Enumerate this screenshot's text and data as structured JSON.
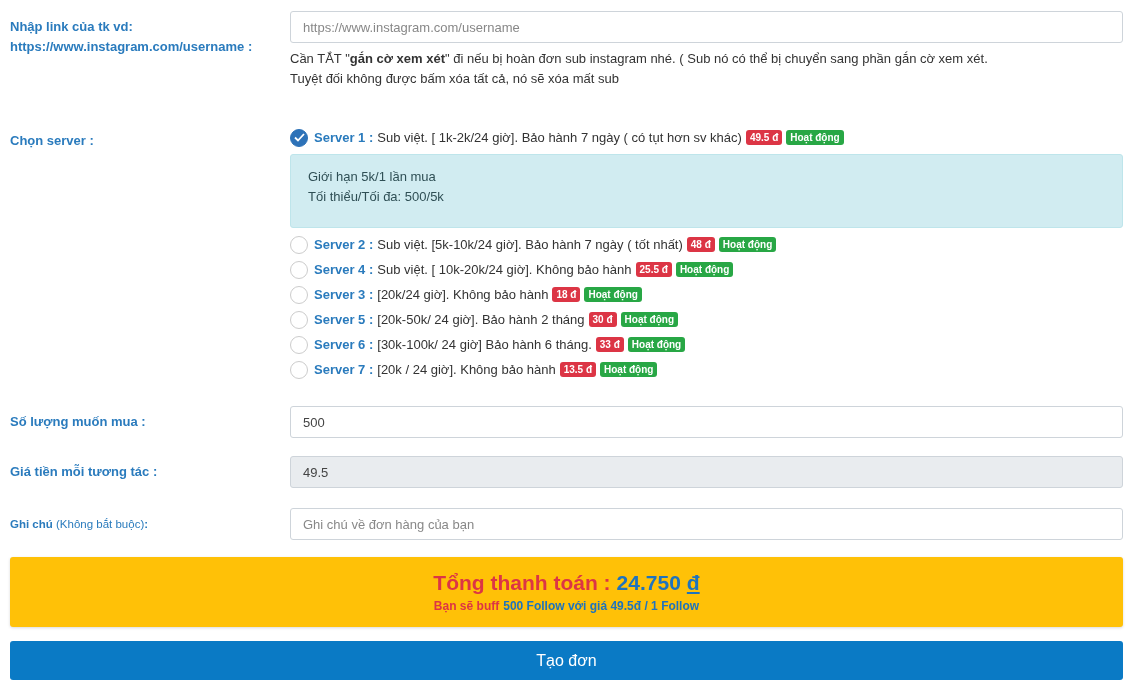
{
  "link_field": {
    "label": "Nhập link của tk vd:",
    "label_example": "https://www.instagram.com/username :",
    "placeholder": "https://www.instagram.com/username",
    "notes": [
      "Cần TẮT \"**gắn cờ xem xét**\" đi nếu bị hoàn đơn sub instagram nhé. ( Sub nó có thể bị chuyển sang phần gắn cờ xem xét.",
      "Tuyệt đối không được bấm xóa tất cả, nó sẽ xóa mất sub"
    ]
  },
  "server_field": {
    "label": "Chọn server :",
    "info": [
      "Giới hạn 5k/1 lần mua",
      "Tối thiểu/Tối đa: 500/5k"
    ],
    "servers": [
      {
        "name": "Server 1 :",
        "description": "Sub việt. [ 1k-2k/24 giờ]. Bảo hành 7 ngày ( có tụt hơn sv khác)",
        "price": "49.5 đ",
        "status": "Hoạt động",
        "selected": true
      },
      {
        "name": "Server 2 :",
        "description": "Sub việt. [5k-10k/24 giờ]. Bảo hành 7 ngày ( tốt nhất)",
        "price": "48 đ",
        "status": "Hoạt động",
        "selected": false
      },
      {
        "name": "Server 4 :",
        "description": "Sub việt. [ 10k-20k/24 giờ]. Không bảo hành",
        "price": "25.5 đ",
        "status": "Hoạt động",
        "selected": false
      },
      {
        "name": "Server 3 :",
        "description": "[20k/24 giờ]. Không bảo hành",
        "price": "18 đ",
        "status": "Hoạt động",
        "selected": false
      },
      {
        "name": "Server 5 :",
        "description": "[20k-50k/ 24 giờ]. Bảo hành 2 tháng",
        "price": "30 đ",
        "status": "Hoạt động",
        "selected": false
      },
      {
        "name": "Server 6 :",
        "description": "[30k-100k/ 24 giờ] Bảo hành 6 tháng.",
        "price": "33 đ",
        "status": "Hoạt động",
        "selected": false
      },
      {
        "name": "Server 7 :",
        "description": "[20k / 24 giờ]. Không bảo hành",
        "price": "13.5 đ",
        "status": "Hoạt động",
        "selected": false
      }
    ]
  },
  "quantity_field": {
    "label": "Số lượng muốn mua :",
    "value": "500"
  },
  "price_field": {
    "label": "Giá tiền mỗi tương tác :",
    "value": "49.5",
    "disabled": true
  },
  "note_field": {
    "label": "**Ghi chú** (Không bắt buộc)**:**",
    "placeholder": "Ghi chú về đơn hàng của bạn"
  },
  "total": {
    "label": "Tổng thanh toán :",
    "amount": "24.750",
    "currency": "đ",
    "summary_prefix": "Bạn sẽ buff",
    "summary_rest": "500 Follow với giá 49.5đ / 1 Follow"
  },
  "submit_button": "Tạo đơn"
}
